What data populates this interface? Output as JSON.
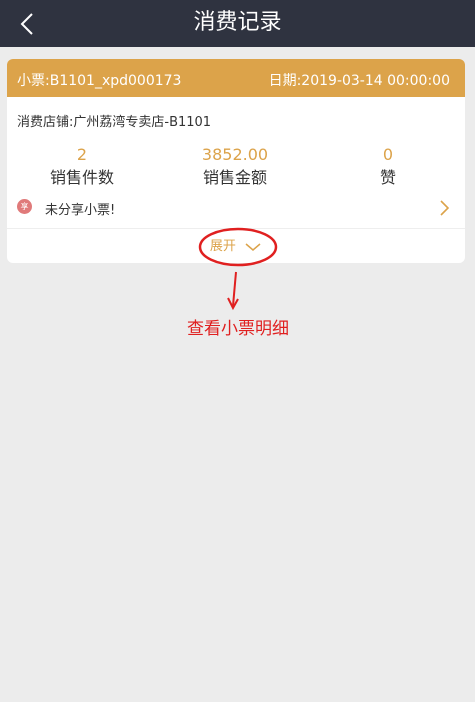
{
  "navbar": {
    "title": "消费记录",
    "back_icon": "chevron-left-icon"
  },
  "receipt": {
    "ticket_no": "小票:B1101_xpd000173",
    "date": "日期:2019-03-14 00:00:00",
    "store": "消费店铺:广州荔湾专卖店-B1101",
    "stats": [
      {
        "value": "2",
        "label": "销售件数"
      },
      {
        "value": "3852.00",
        "label": "销售金额"
      },
      {
        "value": "0",
        "label": "赞"
      }
    ],
    "share_badge": "享",
    "share_text": "未分享小票!",
    "expand_label": "展开"
  },
  "annotation": {
    "text": "查看小票明细"
  },
  "colors": {
    "navbar": "#2f3340",
    "accent": "#dca34a",
    "annotation": "#e02020",
    "background": "#ececec"
  }
}
